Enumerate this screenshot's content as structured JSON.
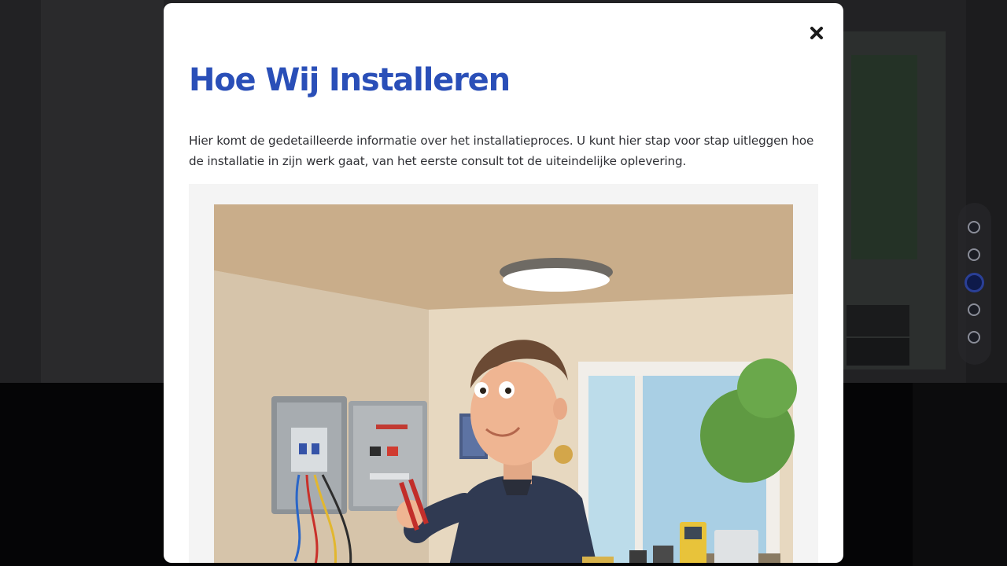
{
  "modal": {
    "title": "Hoe Wij Installeren",
    "body": "Hier komt de gedetailleerde informatie over het installatieproces. U kunt hier stap voor stap uitleggen hoe de installatie in zijn werk gaat, van het eerste consult tot de uiteindelijke oplevering.",
    "close_icon": "close-icon",
    "image": "electrician-installation-illustration"
  },
  "dot_nav": {
    "items": [
      {
        "active": false
      },
      {
        "active": false
      },
      {
        "active": true
      },
      {
        "active": false
      },
      {
        "active": false
      }
    ]
  },
  "colors": {
    "title": "#2a4fb8",
    "text": "#2f3035",
    "overlay": "#1d1d1f",
    "dot_active": "#0e1a4a"
  }
}
